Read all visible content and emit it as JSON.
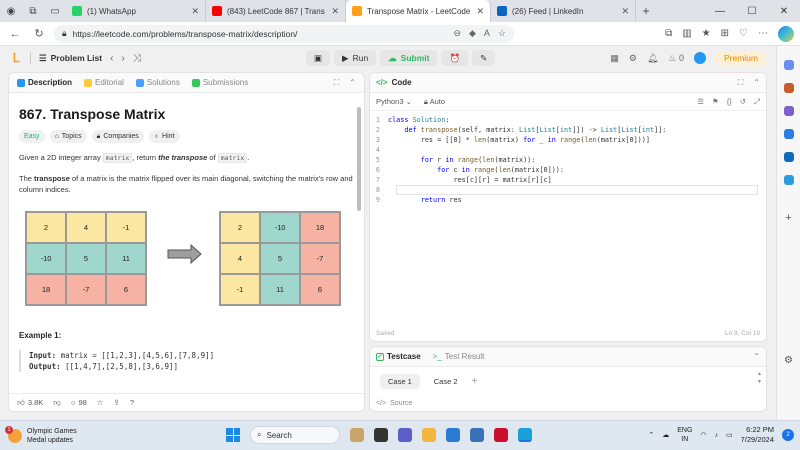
{
  "browser": {
    "tabs": [
      {
        "title": "(1) WhatsApp",
        "color": "#25d366",
        "active": false
      },
      {
        "title": "(843) LeetCode 867 | Trans",
        "color": "#ff0000",
        "active": false
      },
      {
        "title": "Transpose Matrix - LeetCode",
        "color": "#ffa116",
        "active": true
      },
      {
        "title": "(26) Feed | LinkedIn",
        "color": "#0a66c2",
        "active": false
      }
    ],
    "url": "https://leetcode.com/problems/transpose-matrix/description/"
  },
  "lc_header": {
    "problem_list": "Problem List",
    "run": "Run",
    "submit": "Submit",
    "fire_count": "0",
    "premium": "Premium"
  },
  "left_tabs": {
    "description": "Description",
    "editorial": "Editorial",
    "solutions": "Solutions",
    "submissions": "Submissions"
  },
  "problem": {
    "title": "867. Transpose Matrix",
    "difficulty": "Easy",
    "chips": {
      "topics": "Topics",
      "companies": "Companies",
      "hint": "Hint"
    },
    "p1_a": "Given a 2D integer array ",
    "p1_code1": "matrix",
    "p1_b": ", return ",
    "p1_em": "the transpose",
    "p1_c": " of ",
    "p1_code2": "matrix",
    "p1_d": ".",
    "p2_a": "The ",
    "p2_bold": "transpose",
    "p2_b": " of a matrix is the matrix flipped over its main diagonal, switching the matrix's row and column indices.",
    "original": [
      [
        "2",
        "4",
        "-1"
      ],
      [
        "-10",
        "5",
        "11"
      ],
      [
        "18",
        "-7",
        "6"
      ]
    ],
    "original_colors": [
      [
        "y",
        "y",
        "y"
      ],
      [
        "t",
        "t",
        "t"
      ],
      [
        "p",
        "p",
        "p"
      ]
    ],
    "transposed": [
      [
        "2",
        "-10",
        "18"
      ],
      [
        "4",
        "5",
        "-7"
      ],
      [
        "-1",
        "11",
        "6"
      ]
    ],
    "transposed_colors": [
      [
        "y",
        "t",
        "p"
      ],
      [
        "y",
        "t",
        "p"
      ],
      [
        "y",
        "t",
        "p"
      ]
    ],
    "example_heading": "Example 1:",
    "input_label": "Input:",
    "input_value": "matrix = [[1,2,3],[4,5,6],[7,8,9]]",
    "output_label": "Output:",
    "output_value": "[[1,4,7],[2,5,8],[3,6,9]]"
  },
  "left_footer": {
    "likes": "3.8K",
    "comments": "98"
  },
  "code_panel": {
    "title": "Code",
    "language": "Python3",
    "auto": "Auto",
    "saved": "Saved",
    "cursor": "Ln 9, Col 19",
    "lines": [
      "class Solution:",
      "    def transpose(self, matrix: List[List[int]]) -> List[List[int]]:",
      "        res = [[0] * len(matrix) for _ in range(len(matrix[0]))]",
      "",
      "        for r in range(len(matrix)):",
      "            for c in range(len(matrix[0])):",
      "                res[c][r] = matrix[r][c]",
      "",
      "        return res"
    ]
  },
  "testcase": {
    "tab1": "Testcase",
    "tab2": "Test Result",
    "case1": "Case 1",
    "case2": "Case 2",
    "source": "Source"
  },
  "taskbar": {
    "weather_title": "Olympic Games",
    "weather_sub": "Medal updates",
    "weather_badge": "1",
    "search": "Search",
    "lang1": "ENG",
    "lang2": "IN",
    "time": "6:22 PM",
    "date": "7/29/2024",
    "notif_count": "2"
  }
}
